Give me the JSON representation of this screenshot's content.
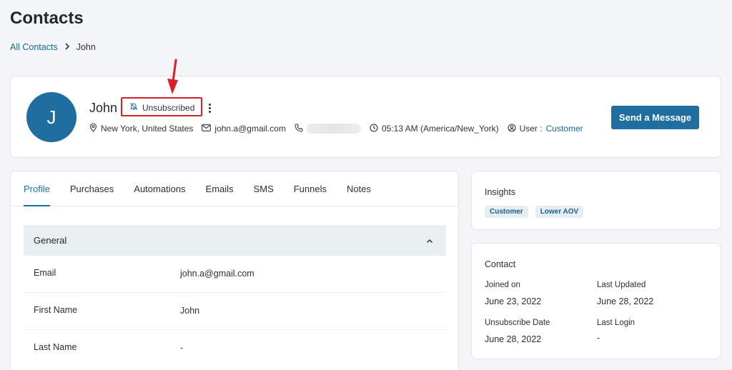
{
  "page": {
    "title": "Contacts"
  },
  "breadcrumb": {
    "root": "All Contacts",
    "separator": "›",
    "current": "John"
  },
  "contact": {
    "initial": "J",
    "name": "John",
    "status": "Unsubscribed",
    "location": "New York, United States",
    "email": "john.a@gmail.com",
    "time": "05:13 AM (America/New_York)",
    "user_label": "User :",
    "user_type": "Customer"
  },
  "actions": {
    "send_message": "Send a Message"
  },
  "tabs": [
    {
      "label": "Profile",
      "active": true
    },
    {
      "label": "Purchases"
    },
    {
      "label": "Automations"
    },
    {
      "label": "Emails"
    },
    {
      "label": "SMS"
    },
    {
      "label": "Funnels"
    },
    {
      "label": "Notes"
    }
  ],
  "general": {
    "title": "General",
    "fields": [
      {
        "label": "Email",
        "value": "john.a@gmail.com"
      },
      {
        "label": "First Name",
        "value": "John"
      },
      {
        "label": "Last Name",
        "value": "-"
      }
    ]
  },
  "insights": {
    "title": "Insights",
    "tags": [
      "Customer",
      "Lower AOV"
    ]
  },
  "contact_info": {
    "title": "Contact",
    "joined_on_label": "Joined on",
    "joined_on": "June 23, 2022",
    "last_updated_label": "Last Updated",
    "last_updated": "June 28, 2022",
    "unsubscribe_date_label": "Unsubscribe Date",
    "unsubscribe_date": "June 28, 2022",
    "last_login_label": "Last Login",
    "last_login": "-"
  },
  "colors": {
    "accent": "#1f6ea0",
    "highlight": "#d92026",
    "link": "#0f6e9c"
  },
  "icons": [
    "bell-off-icon",
    "kebab-menu-icon",
    "location-pin-icon",
    "mail-icon",
    "phone-icon",
    "clock-icon",
    "user-icon",
    "chevron-up-icon",
    "chevron-right-icon"
  ]
}
